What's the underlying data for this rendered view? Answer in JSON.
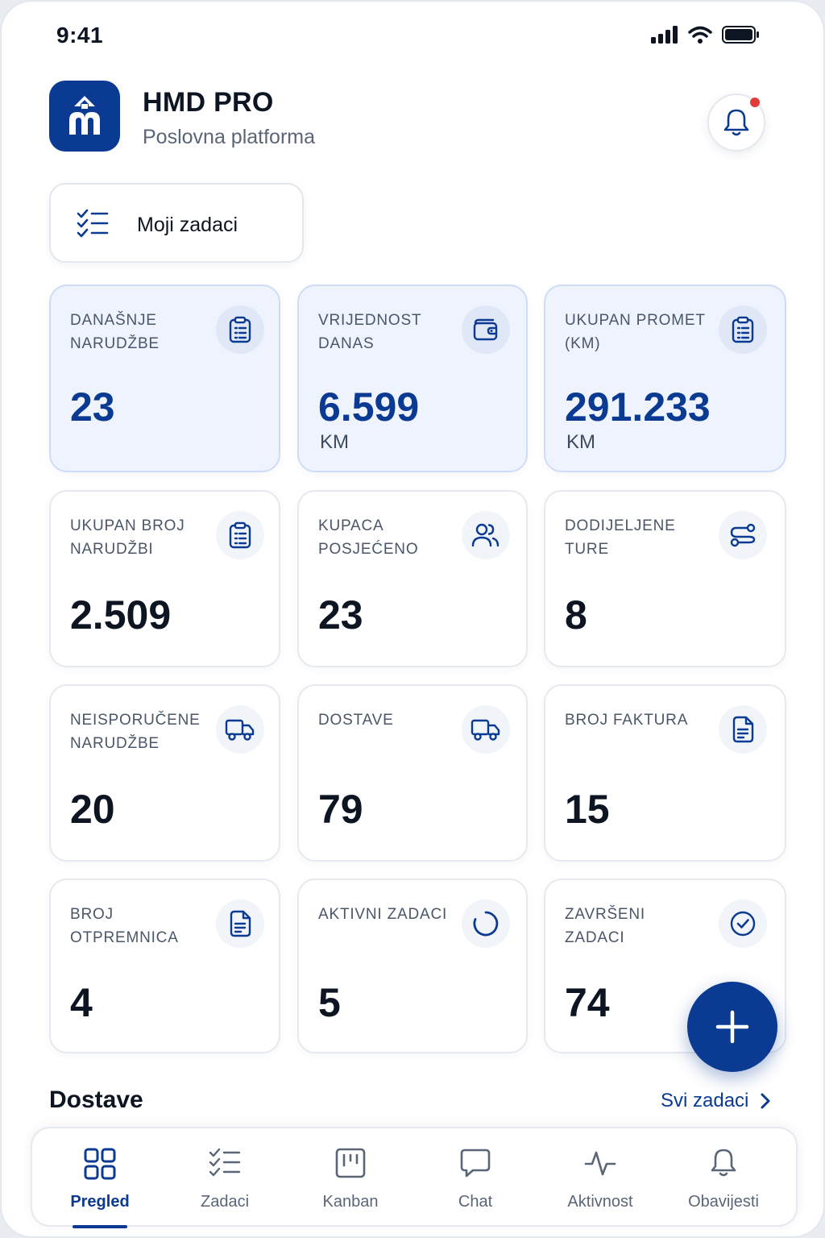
{
  "status_bar": {
    "time": "9:41"
  },
  "header": {
    "title": "HMD PRO",
    "subtitle": "Poslovna platforma"
  },
  "my_tasks_button": {
    "label": "Moji zadaci"
  },
  "colors": {
    "brand": "#0b3a93",
    "notification": "#e23b3b",
    "highlight_bg": "#eef3fd"
  },
  "cards": [
    {
      "label": "DANAŠNJE NARUDŽBE",
      "value": "23",
      "unit": "",
      "icon": "clipboard-icon",
      "highlight": true
    },
    {
      "label": "VRIJEDNOST DANAS",
      "value": "6.599",
      "unit": "KM",
      "icon": "wallet-icon",
      "highlight": true
    },
    {
      "label": "UKUPAN PROMET (KM)",
      "value": "291.233",
      "unit": "KM",
      "icon": "clipboard-icon",
      "highlight": true
    },
    {
      "label": "UKUPAN BROJ NARUDŽBI",
      "value": "2.509",
      "unit": "",
      "icon": "clipboard-icon",
      "highlight": false
    },
    {
      "label": "KUPACA POSJEĆENO",
      "value": "23",
      "unit": "",
      "icon": "users-icon",
      "highlight": false
    },
    {
      "label": "DODIJELJENE TURE",
      "value": "8",
      "unit": "",
      "icon": "route-icon",
      "highlight": false
    },
    {
      "label": "NEISPORUČENE NARUDŽBE",
      "value": "20",
      "unit": "",
      "icon": "truck-icon",
      "highlight": false
    },
    {
      "label": "DOSTAVE",
      "value": "79",
      "unit": "",
      "icon": "truck-icon",
      "highlight": false
    },
    {
      "label": "BROJ FAKTURA",
      "value": "15",
      "unit": "",
      "icon": "document-icon",
      "highlight": false
    },
    {
      "label": "BROJ OTPREMNICA",
      "value": "4",
      "unit": "",
      "icon": "document-icon",
      "highlight": false
    },
    {
      "label": "AKTIVNI ZADACI",
      "value": "5",
      "unit": "",
      "icon": "spinner-icon",
      "highlight": false
    },
    {
      "label": "ZAVRŠENI ZADACI",
      "value": "74",
      "unit": "",
      "icon": "check-circle-icon",
      "highlight": false
    }
  ],
  "section": {
    "title": "Dostave",
    "see_all": "Svi zadaci"
  },
  "tabs": [
    {
      "label": "Pregled",
      "icon": "grid-icon",
      "active": true
    },
    {
      "label": "Zadaci",
      "icon": "checklist-icon",
      "active": false
    },
    {
      "label": "Kanban",
      "icon": "kanban-icon",
      "active": false
    },
    {
      "label": "Chat",
      "icon": "chat-icon",
      "active": false
    },
    {
      "label": "Aktivnost",
      "icon": "activity-icon",
      "active": false
    },
    {
      "label": "Obavijesti",
      "icon": "bell-icon",
      "active": false
    }
  ]
}
